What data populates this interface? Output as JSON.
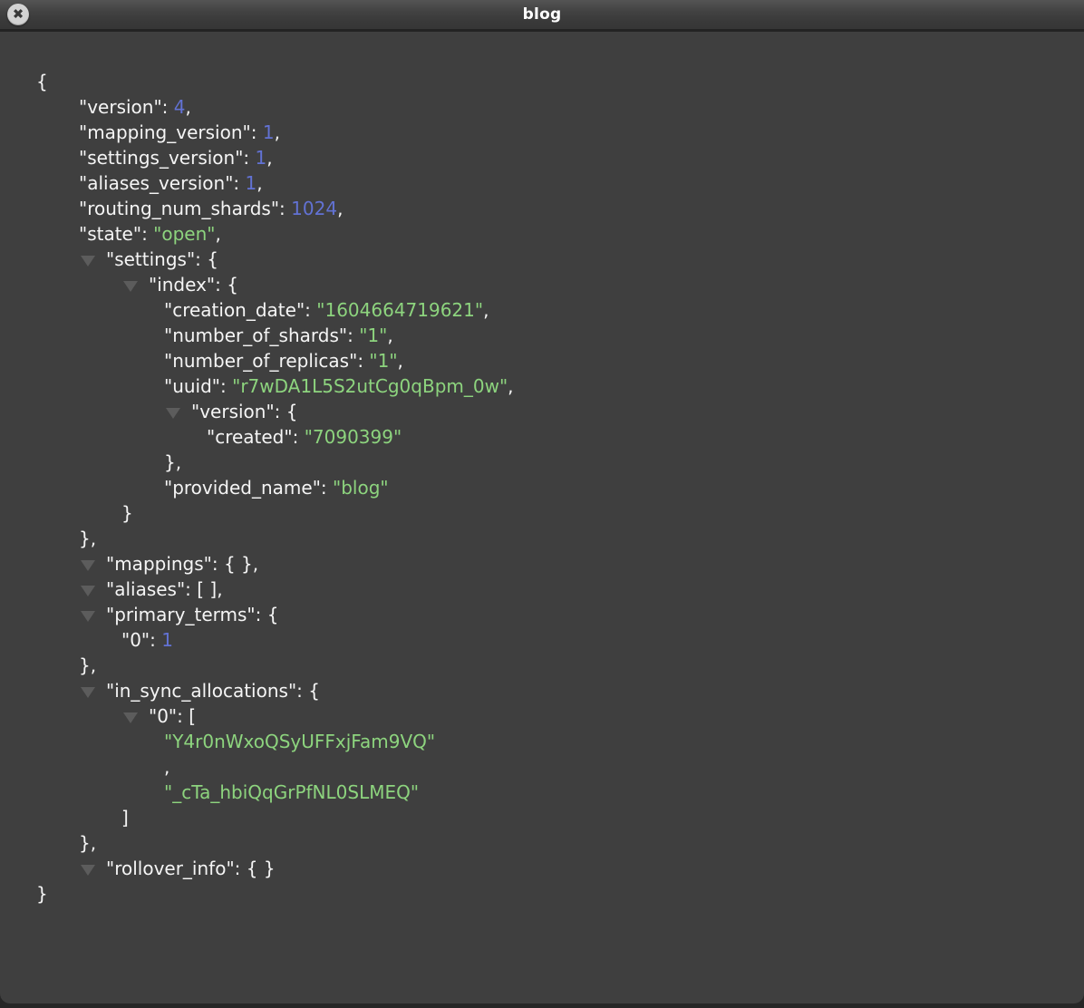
{
  "window": {
    "title": "blog",
    "close_glyph": "✖"
  },
  "colors": {
    "bg": "#3f3f3f",
    "outside": "#262626",
    "text": "#f5f5f5",
    "string": "#8dd47e",
    "number": "#6272d4",
    "triangle": "#5c5c5c"
  },
  "viewer": {
    "indent_base": 40,
    "indent_unit": 47,
    "triangle_text_offset": 0,
    "lines": [
      {
        "indent": 0,
        "expandable": false,
        "segments": [
          {
            "t": "punct",
            "v": "{"
          }
        ]
      },
      {
        "indent": 1,
        "expandable": false,
        "segments": [
          {
            "t": "key",
            "v": "\"version\""
          },
          {
            "t": "punct",
            "v": ": "
          },
          {
            "t": "number",
            "v": "4"
          },
          {
            "t": "punct",
            "v": ","
          }
        ]
      },
      {
        "indent": 1,
        "expandable": false,
        "segments": [
          {
            "t": "key",
            "v": "\"mapping_version\""
          },
          {
            "t": "punct",
            "v": ": "
          },
          {
            "t": "number",
            "v": "1"
          },
          {
            "t": "punct",
            "v": ","
          }
        ]
      },
      {
        "indent": 1,
        "expandable": false,
        "segments": [
          {
            "t": "key",
            "v": "\"settings_version\""
          },
          {
            "t": "punct",
            "v": ": "
          },
          {
            "t": "number",
            "v": "1"
          },
          {
            "t": "punct",
            "v": ","
          }
        ]
      },
      {
        "indent": 1,
        "expandable": false,
        "segments": [
          {
            "t": "key",
            "v": "\"aliases_version\""
          },
          {
            "t": "punct",
            "v": ": "
          },
          {
            "t": "number",
            "v": "1"
          },
          {
            "t": "punct",
            "v": ","
          }
        ]
      },
      {
        "indent": 1,
        "expandable": false,
        "segments": [
          {
            "t": "key",
            "v": "\"routing_num_shards\""
          },
          {
            "t": "punct",
            "v": ": "
          },
          {
            "t": "number",
            "v": "1024"
          },
          {
            "t": "punct",
            "v": ","
          }
        ]
      },
      {
        "indent": 1,
        "expandable": false,
        "segments": [
          {
            "t": "key",
            "v": "\"state\""
          },
          {
            "t": "punct",
            "v": ": "
          },
          {
            "t": "string",
            "v": "\"open\""
          },
          {
            "t": "punct",
            "v": ","
          }
        ]
      },
      {
        "indent": 1,
        "expandable": true,
        "segments": [
          {
            "t": "key",
            "v": "\"settings\""
          },
          {
            "t": "punct",
            "v": ": {"
          }
        ]
      },
      {
        "indent": 2,
        "expandable": true,
        "segments": [
          {
            "t": "key",
            "v": "\"index\""
          },
          {
            "t": "punct",
            "v": ": {"
          }
        ]
      },
      {
        "indent": 3,
        "expandable": false,
        "segments": [
          {
            "t": "key",
            "v": "\"creation_date\""
          },
          {
            "t": "punct",
            "v": ": "
          },
          {
            "t": "string",
            "v": "\"1604664719621\""
          },
          {
            "t": "punct",
            "v": ","
          }
        ]
      },
      {
        "indent": 3,
        "expandable": false,
        "segments": [
          {
            "t": "key",
            "v": "\"number_of_shards\""
          },
          {
            "t": "punct",
            "v": ": "
          },
          {
            "t": "string",
            "v": "\"1\""
          },
          {
            "t": "punct",
            "v": ","
          }
        ]
      },
      {
        "indent": 3,
        "expandable": false,
        "segments": [
          {
            "t": "key",
            "v": "\"number_of_replicas\""
          },
          {
            "t": "punct",
            "v": ": "
          },
          {
            "t": "string",
            "v": "\"1\""
          },
          {
            "t": "punct",
            "v": ","
          }
        ]
      },
      {
        "indent": 3,
        "expandable": false,
        "segments": [
          {
            "t": "key",
            "v": "\"uuid\""
          },
          {
            "t": "punct",
            "v": ": "
          },
          {
            "t": "string",
            "v": "\"r7wDA1L5S2utCg0qBpm_0w\""
          },
          {
            "t": "punct",
            "v": ","
          }
        ]
      },
      {
        "indent": 3,
        "expandable": true,
        "segments": [
          {
            "t": "key",
            "v": "\"version\""
          },
          {
            "t": "punct",
            "v": ": {"
          }
        ]
      },
      {
        "indent": 4,
        "expandable": false,
        "segments": [
          {
            "t": "key",
            "v": "\"created\""
          },
          {
            "t": "punct",
            "v": ": "
          },
          {
            "t": "string",
            "v": "\"7090399\""
          }
        ]
      },
      {
        "indent": 3,
        "expandable": false,
        "segments": [
          {
            "t": "punct",
            "v": "},"
          }
        ]
      },
      {
        "indent": 3,
        "expandable": false,
        "segments": [
          {
            "t": "key",
            "v": "\"provided_name\""
          },
          {
            "t": "punct",
            "v": ": "
          },
          {
            "t": "string",
            "v": "\"blog\""
          }
        ]
      },
      {
        "indent": 2,
        "expandable": false,
        "segments": [
          {
            "t": "punct",
            "v": "}"
          }
        ]
      },
      {
        "indent": 1,
        "expandable": false,
        "segments": [
          {
            "t": "punct",
            "v": "},"
          }
        ]
      },
      {
        "indent": 1,
        "expandable": true,
        "segments": [
          {
            "t": "key",
            "v": "\"mappings\""
          },
          {
            "t": "punct",
            "v": ": { },"
          }
        ]
      },
      {
        "indent": 1,
        "expandable": true,
        "segments": [
          {
            "t": "key",
            "v": "\"aliases\""
          },
          {
            "t": "punct",
            "v": ": [ ],"
          }
        ]
      },
      {
        "indent": 1,
        "expandable": true,
        "segments": [
          {
            "t": "key",
            "v": "\"primary_terms\""
          },
          {
            "t": "punct",
            "v": ": {"
          }
        ]
      },
      {
        "indent": 2,
        "expandable": false,
        "segments": [
          {
            "t": "key",
            "v": "\"0\""
          },
          {
            "t": "punct",
            "v": ": "
          },
          {
            "t": "number",
            "v": "1"
          }
        ]
      },
      {
        "indent": 1,
        "expandable": false,
        "segments": [
          {
            "t": "punct",
            "v": "},"
          }
        ]
      },
      {
        "indent": 1,
        "expandable": true,
        "segments": [
          {
            "t": "key",
            "v": "\"in_sync_allocations\""
          },
          {
            "t": "punct",
            "v": ": {"
          }
        ]
      },
      {
        "indent": 2,
        "expandable": true,
        "segments": [
          {
            "t": "key",
            "v": "\"0\""
          },
          {
            "t": "punct",
            "v": ": ["
          }
        ]
      },
      {
        "indent": 3,
        "expandable": false,
        "segments": [
          {
            "t": "string",
            "v": "\"Y4r0nWxoQSyUFFxjFam9VQ\""
          }
        ]
      },
      {
        "indent": 3,
        "expandable": false,
        "segments": [
          {
            "t": "punct",
            "v": ","
          }
        ]
      },
      {
        "indent": 3,
        "expandable": false,
        "segments": [
          {
            "t": "string",
            "v": "\"_cTa_hbiQqGrPfNL0SLMEQ\""
          }
        ]
      },
      {
        "indent": 2,
        "expandable": false,
        "segments": [
          {
            "t": "punct",
            "v": "]"
          }
        ]
      },
      {
        "indent": 1,
        "expandable": false,
        "segments": [
          {
            "t": "punct",
            "v": "},"
          }
        ]
      },
      {
        "indent": 1,
        "expandable": true,
        "segments": [
          {
            "t": "key",
            "v": "\"rollover_info\""
          },
          {
            "t": "punct",
            "v": ": { }"
          }
        ]
      },
      {
        "indent": 0,
        "expandable": false,
        "segments": [
          {
            "t": "punct",
            "v": "}"
          }
        ]
      }
    ]
  }
}
